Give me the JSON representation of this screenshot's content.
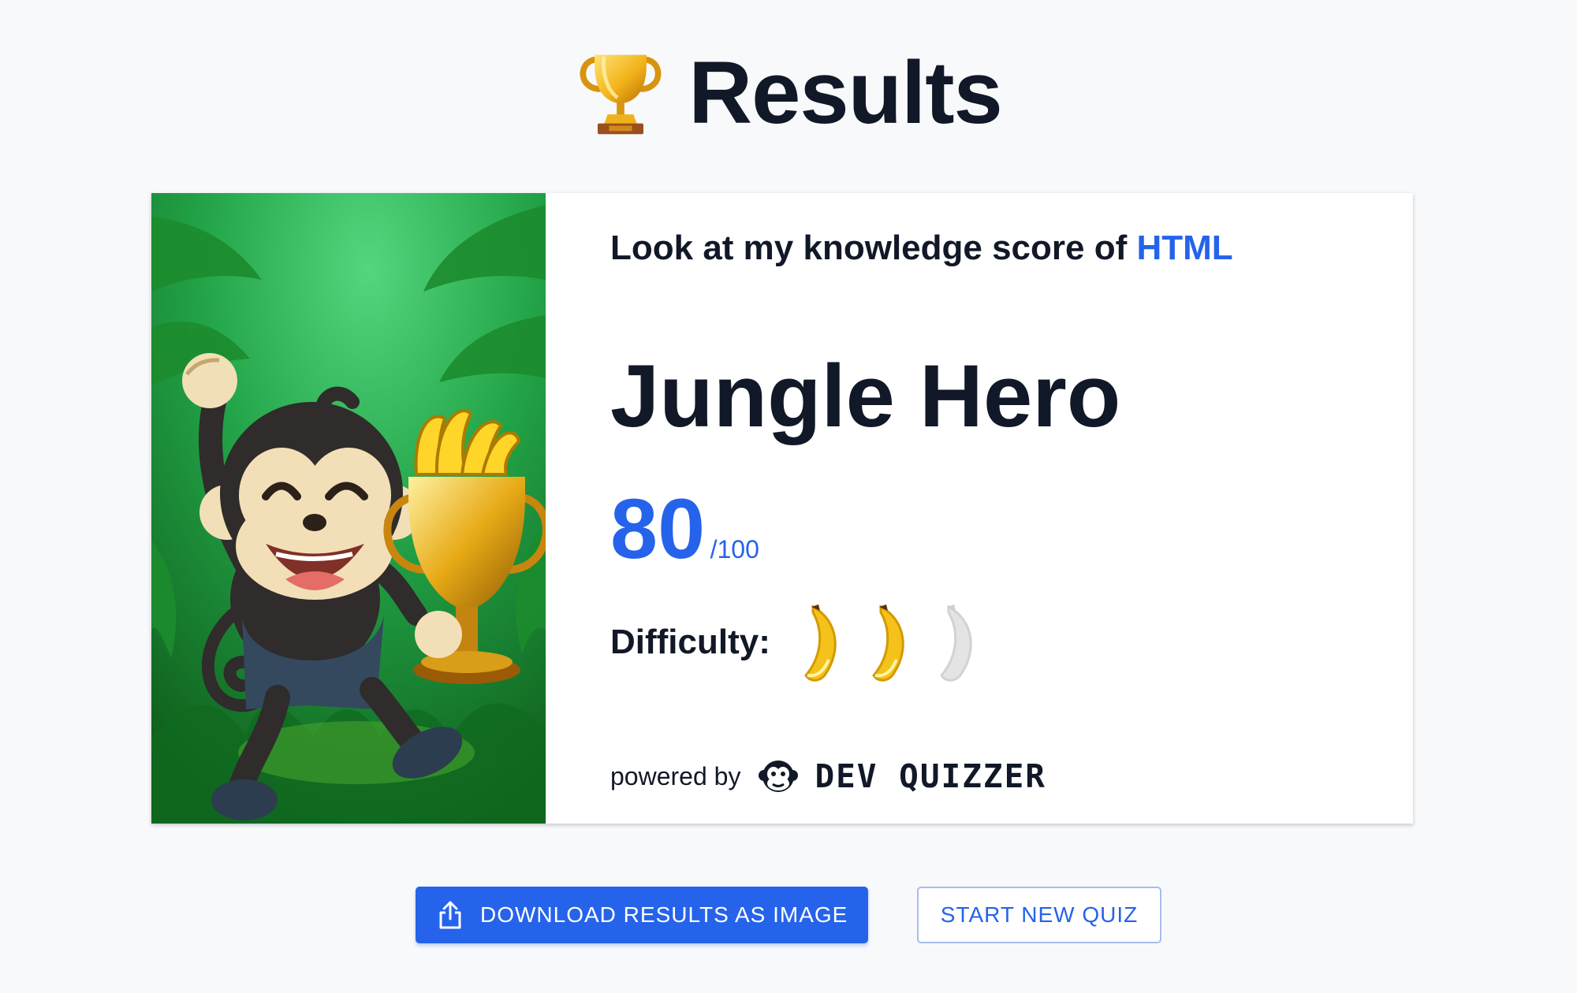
{
  "page": {
    "title": "Results",
    "icon": "trophy-icon"
  },
  "result_card": {
    "intro": "Look at my knowledge score of",
    "topic": "HTML",
    "rank": "Jungle Hero",
    "score": "80",
    "score_max": "/100",
    "difficulty_label": "Difficulty:",
    "difficulty_level": 2,
    "difficulty_max": 3,
    "powered_by": "powered by",
    "brand": "DEV QUIZZER",
    "image": "monkey-holding-trophy-of-bananas-in-jungle"
  },
  "actions": {
    "download_label": "DOWNLOAD RESULTS AS IMAGE",
    "download_icon": "share-upload-icon",
    "new_quiz_label": "START NEW QUIZ"
  },
  "colors": {
    "accent": "#2563eb",
    "text": "#111827",
    "background": "#f7f9fb",
    "banana_filled": "#f4c21a",
    "banana_empty": "#e4e4e4"
  }
}
